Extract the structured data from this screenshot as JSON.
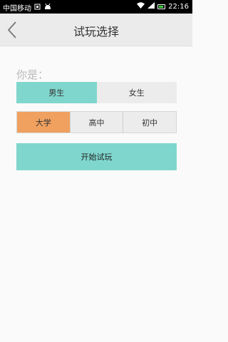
{
  "status_bar": {
    "carrier": "中国移动",
    "time": "22:16",
    "icons": [
      "sim-icon",
      "android-icon",
      "wifi-icon",
      "signal-icon",
      "battery-icon"
    ],
    "battery_color": "#3ad13a"
  },
  "header": {
    "title": "试玩选择",
    "back_icon": "chevron-left-icon"
  },
  "form": {
    "who_label": "你是：",
    "gender_options": [
      {
        "label": "男生",
        "selected": true
      },
      {
        "label": "女生",
        "selected": false
      }
    ],
    "grade_options": [
      {
        "label": "大学",
        "selected": true
      },
      {
        "label": "高中",
        "selected": false
      },
      {
        "label": "初中",
        "selected": false
      }
    ],
    "start_button": "开始试玩"
  },
  "colors": {
    "accent_teal": "#7fd6cd",
    "accent_orange": "#f0a05f",
    "header_bg": "#ebebeb"
  }
}
